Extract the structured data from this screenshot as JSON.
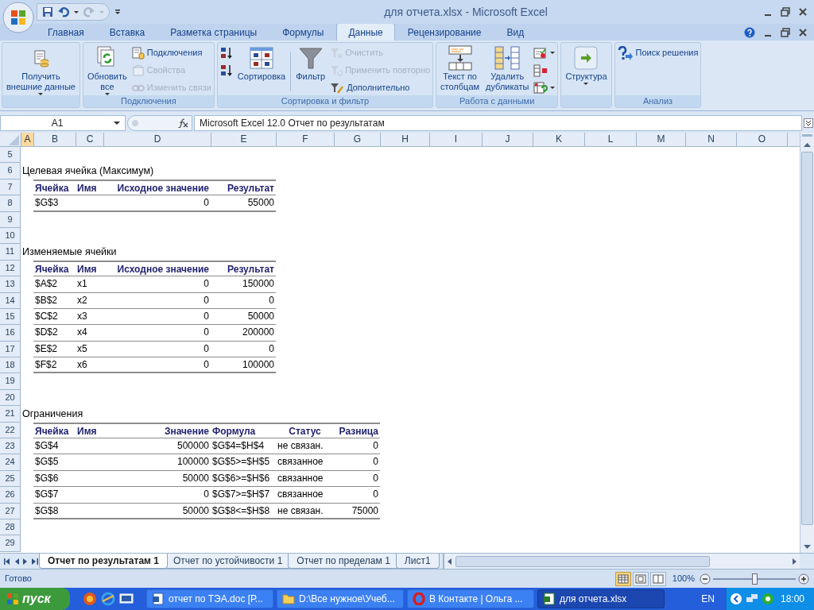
{
  "window": {
    "title": "для отчета.xlsx - Microsoft Excel"
  },
  "tabs": [
    {
      "label": "Главная",
      "selected": false
    },
    {
      "label": "Вставка",
      "selected": false
    },
    {
      "label": "Разметка страницы",
      "selected": false
    },
    {
      "label": "Формулы",
      "selected": false
    },
    {
      "label": "Данные",
      "selected": true
    },
    {
      "label": "Рецензирование",
      "selected": false
    },
    {
      "label": "Вид",
      "selected": false
    }
  ],
  "ribbon": {
    "groups": [
      {
        "items": [
          {
            "kind": "large",
            "lines": [
              "Получить",
              "внешние данные"
            ],
            "dropdown": true,
            "disabled": false
          }
        ]
      },
      {
        "label": "Подключения",
        "items": [
          {
            "kind": "large",
            "lines": [
              "Обновить",
              "все"
            ],
            "dropdown": true,
            "disabled": false
          },
          {
            "kind": "stack",
            "buttons": [
              {
                "label": "Подключения",
                "disabled": false
              },
              {
                "label": "Свойства",
                "disabled": true
              },
              {
                "label": "Изменить связи",
                "disabled": true
              }
            ]
          }
        ]
      },
      {
        "label": "Сортировка и фильтр",
        "items": [
          {
            "kind": "stack",
            "buttons": [
              {
                "disabled": false
              },
              {
                "disabled": false
              }
            ]
          },
          {
            "kind": "large",
            "lines": [
              "Сортировка"
            ],
            "dropdown": false,
            "disabled": false
          },
          {
            "kind": "separator"
          },
          {
            "kind": "large",
            "lines": [
              "Фильтр"
            ],
            "dropdown": false,
            "disabled": false
          },
          {
            "kind": "stack",
            "buttons": [
              {
                "label": "Очистить",
                "disabled": true
              },
              {
                "label": "Применить повторно",
                "disabled": true
              },
              {
                "label": "Дополнительно",
                "disabled": false
              }
            ]
          }
        ]
      },
      {
        "label": "Работа с данными",
        "items": [
          {
            "kind": "large",
            "lines": [
              "Текст по",
              "столбцам"
            ],
            "dropdown": false,
            "disabled": false
          },
          {
            "kind": "large",
            "lines": [
              "Удалить",
              "дубликаты"
            ],
            "dropdown": false,
            "disabled": false
          },
          {
            "kind": "stack",
            "buttons": [
              {
                "dropdown": true,
                "disabled": false
              },
              {
                "dropdown": false,
                "disabled": false
              },
              {
                "dropdown": true,
                "disabled": false
              }
            ]
          }
        ]
      },
      {
        "items": [
          {
            "kind": "large",
            "lines": [
              "Структура"
            ],
            "dropdown": true,
            "disabled": false
          }
        ]
      },
      {
        "label": "Анализ",
        "items": [
          {
            "kind": "stack",
            "buttons": [
              {
                "label": "Поиск решения",
                "disabled": false
              }
            ]
          }
        ]
      }
    ]
  },
  "formula_bar": {
    "name_box": "A1",
    "formula": "Microsoft Excel 12.0 Отчет по результатам"
  },
  "column_headers": [
    {
      "label": "A",
      "selected": true
    },
    {
      "label": "B",
      "selected": false
    },
    {
      "label": "C",
      "selected": false
    },
    {
      "label": "D",
      "selected": false
    },
    {
      "label": "E",
      "selected": false
    },
    {
      "label": "F",
      "selected": false
    },
    {
      "label": "G",
      "selected": false
    },
    {
      "label": "H",
      "selected": false
    },
    {
      "label": "I",
      "selected": false
    },
    {
      "label": "J",
      "selected": false
    },
    {
      "label": "K",
      "selected": false
    },
    {
      "label": "L",
      "selected": false
    },
    {
      "label": "M",
      "selected": false
    },
    {
      "label": "N",
      "selected": false
    },
    {
      "label": "O",
      "selected": false
    }
  ],
  "row_headers": [
    "5",
    "6",
    "7",
    "8",
    "9",
    "10",
    "11",
    "12",
    "13",
    "14",
    "15",
    "16",
    "17",
    "18",
    "19",
    "20",
    "21",
    "22",
    "23",
    "24",
    "25",
    "26",
    "27",
    "28",
    "29"
  ],
  "sheet": {
    "sections": [
      {
        "title": "Целевая ячейка (Максимум)",
        "columns": [
          {
            "kind": "text",
            "label": "Ячейка"
          },
          {
            "kind": "text",
            "label": "Имя"
          },
          {
            "kind": "number",
            "label": "Исходное значение"
          },
          {
            "kind": "number",
            "label": "Результат"
          }
        ],
        "rows": [
          {
            "cell": "$G$3",
            "values": [
              "0",
              "55000"
            ]
          }
        ]
      },
      {
        "title": "Изменяемые ячейки",
        "columns": [
          {
            "kind": "text",
            "label": "Ячейка"
          },
          {
            "kind": "text",
            "label": "Имя"
          },
          {
            "kind": "number",
            "label": "Исходное значение"
          },
          {
            "kind": "number",
            "label": "Результат"
          }
        ],
        "rows": [
          {
            "cell": "$A$2",
            "name": "x1",
            "values": [
              "0",
              "150000"
            ]
          },
          {
            "cell": "$B$2",
            "name": "x2",
            "values": [
              "0",
              "0"
            ]
          },
          {
            "cell": "$C$2",
            "name": "x3",
            "values": [
              "0",
              "50000"
            ]
          },
          {
            "cell": "$D$2",
            "name": "x4",
            "values": [
              "0",
              "200000"
            ]
          },
          {
            "cell": "$E$2",
            "name": "x5",
            "values": [
              "0",
              "0"
            ]
          },
          {
            "cell": "$F$2",
            "name": "x6",
            "values": [
              "0",
              "100000"
            ]
          }
        ]
      },
      {
        "title": "Ограничения",
        "columns": [
          {
            "kind": "text",
            "label": "Ячейка"
          },
          {
            "kind": "text",
            "label": "Имя"
          },
          {
            "kind": "number",
            "label": "Значение"
          },
          {
            "kind": "text",
            "label": "Формула"
          },
          {
            "kind": "status",
            "label": "Статус"
          },
          {
            "kind": "number",
            "label": "Разница"
          }
        ],
        "rows": [
          {
            "cell": "$G$4",
            "values": [
              "500000",
              "$G$4=$H$4",
              "не связан.",
              "0"
            ]
          },
          {
            "cell": "$G$5",
            "values": [
              "100000",
              "$G$5>=$H$5",
              "связанное",
              "0"
            ]
          },
          {
            "cell": "$G$6",
            "values": [
              "50000",
              "$G$6>=$H$6",
              "связанное",
              "0"
            ]
          },
          {
            "cell": "$G$7",
            "values": [
              "0",
              "$G$7>=$H$7",
              "связанное",
              "0"
            ]
          },
          {
            "cell": "$G$8",
            "values": [
              "50000",
              "$G$8<=$H$8",
              "не связан.",
              "75000"
            ]
          }
        ]
      }
    ]
  },
  "sheet_tabs": [
    {
      "label": "Отчет по результатам 1",
      "selected": true
    },
    {
      "label": "Отчет по устойчивости 1",
      "selected": false
    },
    {
      "label": "Отчет по пределам 1",
      "selected": false
    },
    {
      "label": "Лист1",
      "selected": false
    }
  ],
  "status_bar": {
    "text": "Готово",
    "views": [
      {
        "selected": true
      },
      {
        "selected": false
      },
      {
        "selected": false
      }
    ],
    "zoom": "100%",
    "zoom_slider": {
      "level": 0.5
    }
  },
  "taskbar": {
    "start": "пуск",
    "tasks": [
      {
        "label": "отчет по ТЭА.doc [Р...",
        "selected": false
      },
      {
        "label": "D:\\Все нужное\\Учеб...",
        "selected": false
      },
      {
        "label": "В Контакте | Ольга ...",
        "selected": false
      },
      {
        "label": "для отчета.xlsx",
        "selected": true
      }
    ],
    "language": "EN",
    "clock": "18:00"
  }
}
